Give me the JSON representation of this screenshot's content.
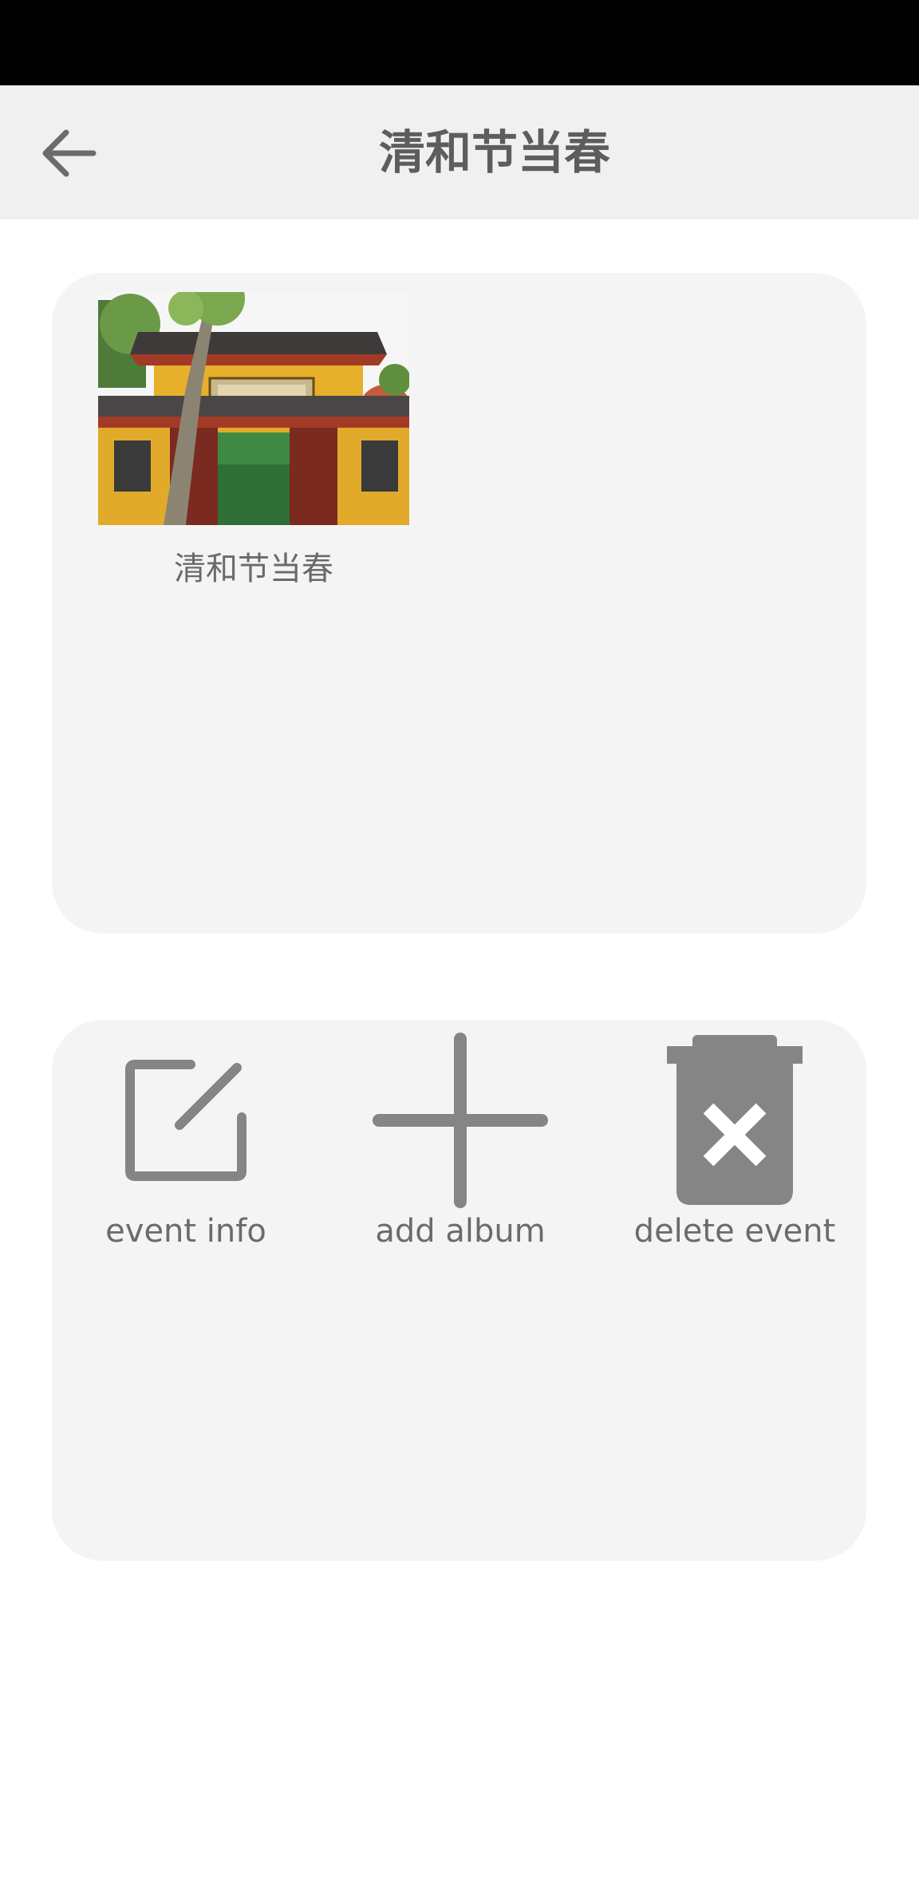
{
  "header": {
    "title": "清和节当春",
    "back_icon": "arrow-left-icon"
  },
  "albums": [
    {
      "name": "清和节当春",
      "thumbnail": "temple-gate-photo"
    }
  ],
  "actions": [
    {
      "label": "event info",
      "icon": "edit-icon"
    },
    {
      "label": "add album",
      "icon": "plus-icon"
    },
    {
      "label": "delete event",
      "icon": "trash-x-icon"
    }
  ],
  "colors": {
    "status_bar": "#000000",
    "app_bar": "#f0f0f0",
    "card": "#f4f4f4",
    "icon": "#858585",
    "text": "#6b6b6b"
  }
}
